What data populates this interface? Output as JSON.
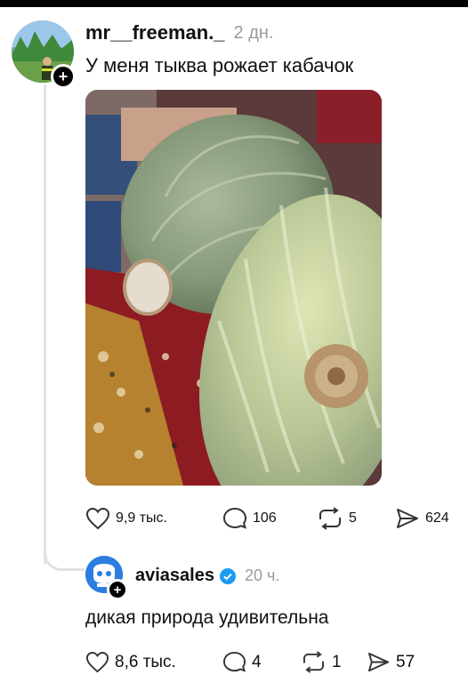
{
  "post": {
    "username": "mr__freeman._",
    "time": "2 дн.",
    "text": "У меня тыква рожает кабачок",
    "likes": "9,9 тыс.",
    "comments": "106",
    "reposts": "5",
    "shares": "624"
  },
  "reply": {
    "username": "aviasales",
    "time": "20 ч.",
    "text": "дикая природа удивительна",
    "likes": "8,6 тыс.",
    "comments": "4",
    "reposts": "1",
    "shares": "57"
  },
  "colors": {
    "verified": "#1d9bf0",
    "aviasales_brand": "#2b7de0",
    "muted": "#9a9a9a"
  }
}
